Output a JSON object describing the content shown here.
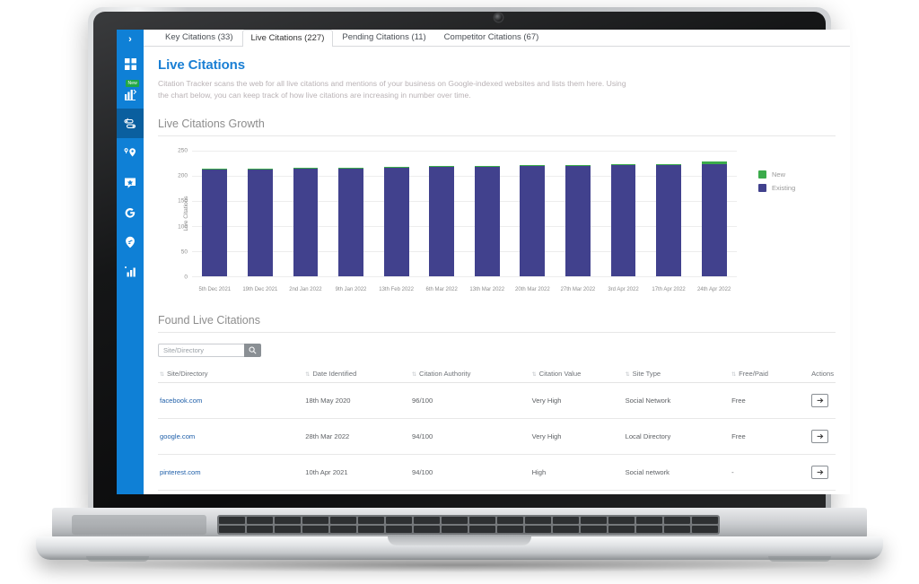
{
  "device": {
    "kind": "laptop",
    "webcam": "webcam-dot"
  },
  "sidebar": {
    "toggle_label": "›",
    "items": [
      {
        "name": "dashboard",
        "icon": "grid-icon",
        "badge": ""
      },
      {
        "name": "rank-tracker",
        "icon": "bar-chart-arrow-icon",
        "badge": "New"
      },
      {
        "name": "citation-tracker",
        "icon": "citation-icon",
        "badge": ""
      },
      {
        "name": "local-search",
        "icon": "map-pin-icon",
        "badge": ""
      },
      {
        "name": "reviews",
        "icon": "star-card-icon",
        "badge": ""
      },
      {
        "name": "google",
        "icon": "google-g-icon",
        "badge": ""
      },
      {
        "name": "locations",
        "icon": "location-drop-icon",
        "badge": ""
      },
      {
        "name": "reports",
        "icon": "bar-chart-icon",
        "badge": ""
      }
    ]
  },
  "tabs": [
    {
      "label": "Key Citations (33)",
      "active": false
    },
    {
      "label": "Live Citations (227)",
      "active": true
    },
    {
      "label": "Pending Citations (11)",
      "active": false
    },
    {
      "label": "Competitor Citations (67)",
      "active": false
    }
  ],
  "page": {
    "title": "Live Citations",
    "description": "Citation Tracker scans the web for all live citations and mentions of your business on Google-indexed websites and lists them here. Using the chart below, you can keep track of how live citations are increasing in number over time."
  },
  "sections": {
    "chart_title": "Live Citations Growth",
    "table_title": "Found Live Citations"
  },
  "search": {
    "placeholder": "Site/Directory",
    "value": "",
    "button_icon": "search-icon"
  },
  "table": {
    "columns": [
      {
        "label": "Site/Directory",
        "sortable": true
      },
      {
        "label": "Date Identified",
        "sortable": true
      },
      {
        "label": "Citation Authority",
        "sortable": true
      },
      {
        "label": "Citation Value",
        "sortable": true
      },
      {
        "label": "Site Type",
        "sortable": true
      },
      {
        "label": "Free/Paid",
        "sortable": true
      },
      {
        "label": "Actions",
        "sortable": false
      }
    ],
    "rows": [
      {
        "site": "facebook.com",
        "date": "18th May 2020",
        "authority": "96/100",
        "value": "Very High",
        "type": "Social Network",
        "freepaid": "Free",
        "action_icon": "arrow-right-icon"
      },
      {
        "site": "google.com",
        "date": "28th Mar 2022",
        "authority": "94/100",
        "value": "Very High",
        "type": "Local Directory",
        "freepaid": "Free",
        "action_icon": "arrow-right-icon"
      },
      {
        "site": "pinterest.com",
        "date": "10th Apr 2021",
        "authority": "94/100",
        "value": "High",
        "type": "Social network",
        "freepaid": "-",
        "action_icon": "arrow-right-icon"
      }
    ]
  },
  "colors": {
    "brand_blue": "#0f80d6",
    "title_blue": "#1a7fd4",
    "bar_existing": "#41418d",
    "bar_new": "#3bab4b",
    "sidebar_active": "#0a5f9f",
    "badge_green": "#21a745"
  },
  "chart_data": {
    "type": "bar",
    "stacked": true,
    "title": "Live Citations Growth",
    "xlabel": "",
    "ylabel": "Live Citations",
    "ylim": [
      0,
      250
    ],
    "yticks": [
      0,
      50,
      100,
      150,
      200,
      250
    ],
    "grid": true,
    "legend_position": "right",
    "categories": [
      "5th Dec 2021",
      "19th Dec 2021",
      "2nd Jan 2022",
      "9th Jan 2022",
      "13th Feb 2022",
      "6th Mar 2022",
      "13th Mar 2022",
      "20th Mar 2022",
      "27th Mar 2022",
      "3rd Apr 2022",
      "17th Apr 2022",
      "24th Apr 2022"
    ],
    "series": [
      {
        "name": "Existing",
        "color": "#41418d",
        "values": [
          212,
          213,
          214,
          215,
          216,
          217,
          218,
          219,
          220,
          221,
          222,
          224
        ]
      },
      {
        "name": "New",
        "color": "#3bab4b",
        "values": [
          2,
          2,
          2,
          2,
          2,
          2,
          2,
          2,
          2,
          2,
          2,
          4
        ]
      }
    ],
    "totals": [
      214,
      215,
      216,
      217,
      218,
      219,
      220,
      221,
      222,
      223,
      224,
      228
    ]
  }
}
